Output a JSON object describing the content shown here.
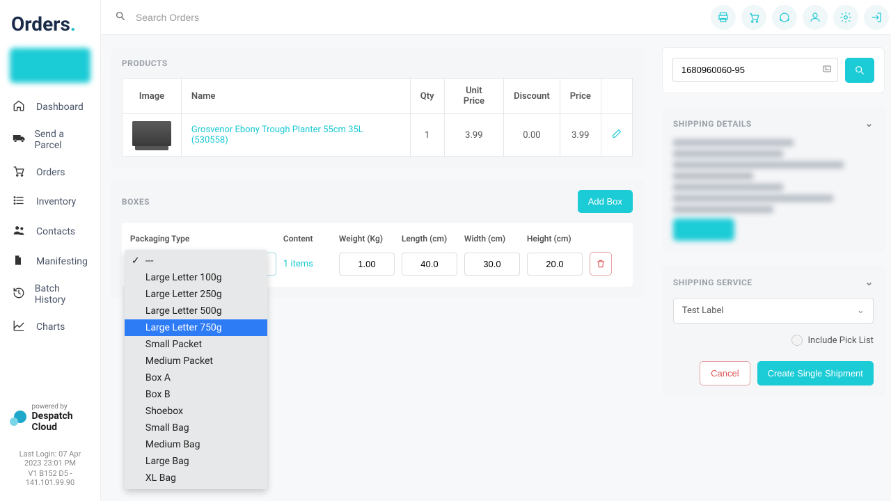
{
  "brand": {
    "name": "Orders"
  },
  "search": {
    "placeholder": "Search Orders"
  },
  "sidebar": {
    "items": [
      {
        "label": "Dashboard"
      },
      {
        "label": "Send a Parcel"
      },
      {
        "label": "Orders"
      },
      {
        "label": "Inventory"
      },
      {
        "label": "Contacts"
      },
      {
        "label": "Manifesting"
      },
      {
        "label": "Batch History"
      },
      {
        "label": "Charts"
      }
    ]
  },
  "footer": {
    "powered_small": "powered by",
    "powered_big": "Despatch Cloud",
    "last_login": "Last Login: 07 Apr 2023 23:01 PM",
    "build": "V1 B152 D5 - 141.101.99.90"
  },
  "products": {
    "title": "PRODUCTS",
    "headers": {
      "image": "Image",
      "name": "Name",
      "qty": "Qty",
      "unit": "Unit Price",
      "discount": "Discount",
      "price": "Price"
    },
    "rows": [
      {
        "name": "Grosvenor Ebony Trough Planter 55cm 35L (530558)",
        "qty": "1",
        "unit": "3.99",
        "discount": "0.00",
        "price": "3.99"
      }
    ]
  },
  "boxes": {
    "title": "BOXES",
    "add_label": "Add Box",
    "headers": {
      "packaging": "Packaging Type",
      "content": "Content",
      "weight": "Weight (Kg)",
      "length": "Length (cm)",
      "width": "Width (cm)",
      "height": "Height (cm)"
    },
    "row": {
      "content": "1 items",
      "weight": "1.00",
      "length": "40.0",
      "width": "30.0",
      "height": "20.0"
    },
    "dropdown": {
      "selected": "---",
      "highlighted": "Large Letter 750g",
      "options": [
        "---",
        "Large Letter 100g",
        "Large Letter 250g",
        "Large Letter 500g",
        "Large Letter 750g",
        "Small Packet",
        "Medium Packet",
        "Box A",
        "Box B",
        "Shoebox",
        "Small Bag",
        "Medium Bag",
        "Large Bag",
        "XL Bag"
      ]
    }
  },
  "order_search": {
    "value": "1680960060-95"
  },
  "shipping_details": {
    "title": "SHIPPING DETAILS"
  },
  "shipping_service": {
    "title": "SHIPPING SERVICE",
    "selected": "Test Label",
    "include_label": "Include Pick List",
    "cancel": "Cancel",
    "create": "Create Single Shipment"
  }
}
